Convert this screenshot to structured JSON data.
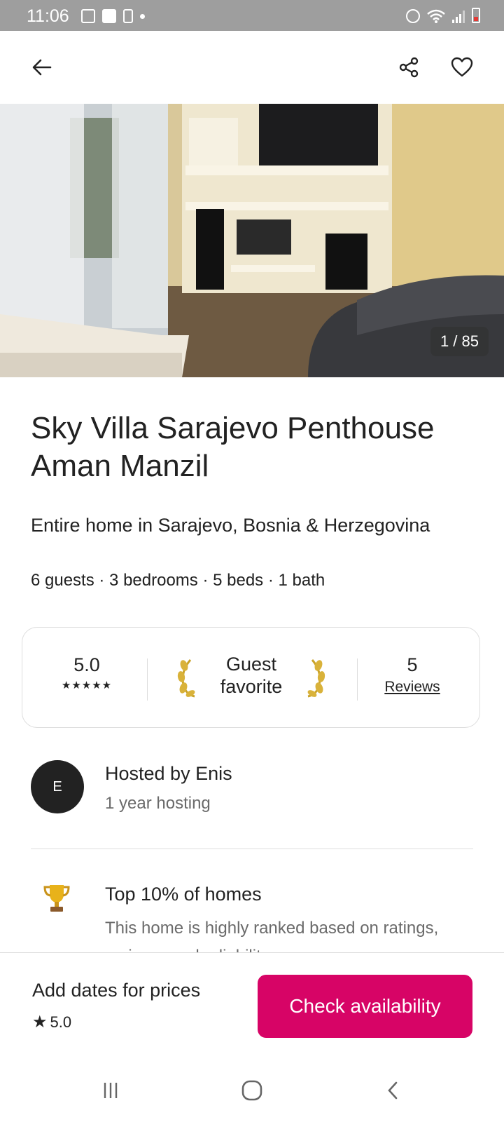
{
  "status_bar": {
    "time": "11:06",
    "icons_left": [
      "gallery-icon",
      "person-shield-icon",
      "sim-alert-icon",
      "dot-icon"
    ],
    "icons_right": [
      "alarm-icon",
      "wifi-icon",
      "signal-icon",
      "battery-low-icon"
    ]
  },
  "header": {
    "icons": [
      "back-arrow-icon",
      "share-icon",
      "heart-icon"
    ]
  },
  "photo": {
    "counter": "1 / 85"
  },
  "listing": {
    "title": "Sky Villa Sarajevo Penthouse Aman Manzil",
    "subtitle": "Entire home in Sarajevo, Bosnia & Herzegovina",
    "details": "6 guests · 3 bedrooms · 5 beds · 1 bath"
  },
  "rating_card": {
    "rating": "5.0",
    "stars": "★★★★★",
    "badge": "Guest favorite",
    "reviews_count": "5",
    "reviews_label": "Reviews"
  },
  "host": {
    "initial": "E",
    "name": "Hosted by Enis",
    "subtitle": "1 year hosting"
  },
  "highlight": {
    "title": "Top 10% of homes",
    "description": "This home is highly ranked based on ratings, reviews, and reliability."
  },
  "booking": {
    "price_text": "Add dates for prices",
    "rating": "5.0",
    "button": "Check availability",
    "button_color": "#d70466"
  },
  "nav": {
    "icons": [
      "recent-apps-icon",
      "home-icon",
      "back-icon"
    ]
  }
}
